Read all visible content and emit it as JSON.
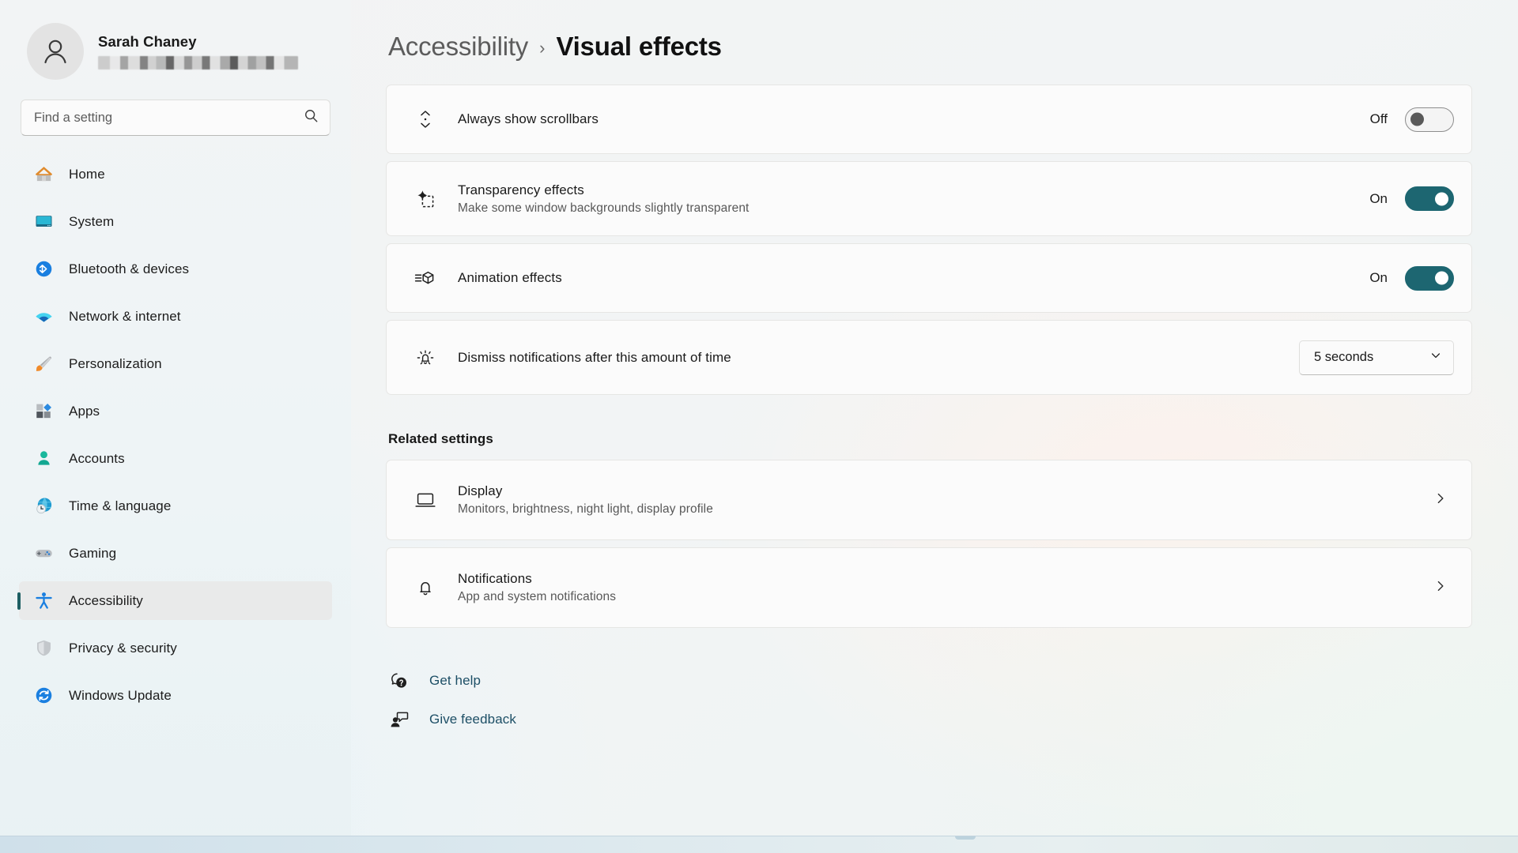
{
  "profile": {
    "name": "Sarah Chaney",
    "email_redacted": true
  },
  "search": {
    "placeholder": "Find a setting",
    "value": "",
    "icon": "search-icon"
  },
  "sidebar": {
    "items": [
      {
        "label": "Home",
        "icon": "home-icon",
        "selected": false
      },
      {
        "label": "System",
        "icon": "system-monitor-icon",
        "selected": false
      },
      {
        "label": "Bluetooth & devices",
        "icon": "bluetooth-icon",
        "selected": false
      },
      {
        "label": "Network & internet",
        "icon": "wifi-icon",
        "selected": false
      },
      {
        "label": "Personalization",
        "icon": "paintbrush-icon",
        "selected": false
      },
      {
        "label": "Apps",
        "icon": "apps-icon",
        "selected": false
      },
      {
        "label": "Accounts",
        "icon": "account-person-icon",
        "selected": false
      },
      {
        "label": "Time & language",
        "icon": "globe-clock-icon",
        "selected": false
      },
      {
        "label": "Gaming",
        "icon": "gamepad-icon",
        "selected": false
      },
      {
        "label": "Accessibility",
        "icon": "accessibility-person-icon",
        "selected": true
      },
      {
        "label": "Privacy & security",
        "icon": "shield-icon",
        "selected": false
      },
      {
        "label": "Windows Update",
        "icon": "update-refresh-icon",
        "selected": false
      }
    ]
  },
  "breadcrumb": {
    "parent": "Accessibility",
    "separator": "›",
    "current": "Visual effects"
  },
  "settings": [
    {
      "title": "Always show scrollbars",
      "subtitle": "",
      "icon": "scrollbar-icon",
      "control": "toggle",
      "state_label": "Off",
      "state": "off"
    },
    {
      "title": "Transparency effects",
      "subtitle": "Make some window backgrounds slightly transparent",
      "icon": "transparency-sparkle-icon",
      "control": "toggle",
      "state_label": "On",
      "state": "on"
    },
    {
      "title": "Animation effects",
      "subtitle": "",
      "icon": "animation-cube-icon",
      "control": "toggle",
      "state_label": "On",
      "state": "on"
    },
    {
      "title": "Dismiss notifications after this amount of time",
      "subtitle": "",
      "icon": "notification-bell-timer-icon",
      "control": "dropdown",
      "state_label": "5 seconds",
      "state": ""
    }
  ],
  "related": {
    "heading": "Related settings",
    "items": [
      {
        "title": "Display",
        "subtitle": "Monitors, brightness, night light, display profile",
        "icon": "display-monitor-icon"
      },
      {
        "title": "Notifications",
        "subtitle": "App and system notifications",
        "icon": "bell-icon"
      }
    ]
  },
  "help": {
    "links": [
      {
        "label": "Get help",
        "icon": "help-question-bubble-icon"
      },
      {
        "label": "Give feedback",
        "icon": "feedback-person-bubble-icon"
      }
    ]
  },
  "colors": {
    "accent_teal": "#1d6671",
    "selection_bar": "#1d5f63",
    "link_text": "#1d4f66",
    "card_bg": "#fbfbfb"
  }
}
